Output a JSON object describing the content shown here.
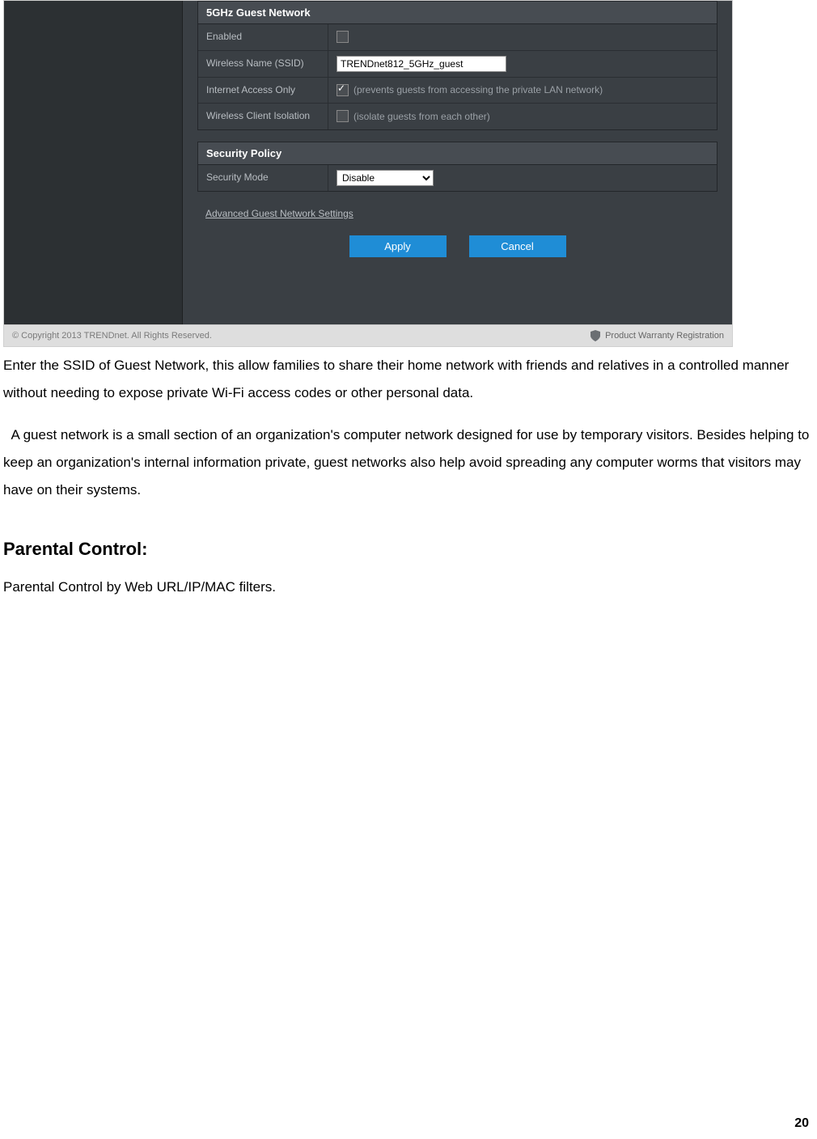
{
  "router": {
    "guest_header": "5GHz Guest Network",
    "rows": {
      "enabled_label": "Enabled",
      "ssid_label": "Wireless Name (SSID)",
      "ssid_value": "TRENDnet812_5GHz_guest",
      "iao_label": "Internet Access Only",
      "iao_note": "(prevents guests from accessing the private LAN network)",
      "wci_label": "Wireless Client Isolation",
      "wci_note": "(isolate guests from each other)"
    },
    "sec_header": "Security Policy",
    "sec_mode_label": "Security Mode",
    "sec_mode_value": "Disable",
    "adv_link": "Advanced Guest Network Settings",
    "apply": "Apply",
    "cancel": "Cancel",
    "footer_left": "© Copyright 2013 TRENDnet. All Rights Reserved.",
    "footer_right": "Product Warranty Registration"
  },
  "doc": {
    "p1": "Enter the SSID of Guest Network, this allow families to share their home network with friends and relatives in a controlled manner without needing to expose private Wi-Fi access codes or other personal data.",
    "p2": "  A guest network is a small section of an organization's computer network designed for use by temporary visitors. Besides helping to keep an organization's internal information private, guest networks also help avoid spreading any computer worms that visitors may have on their systems.",
    "h2": "Parental Control:",
    "p3": "Parental Control by Web URL/IP/MAC filters."
  },
  "page_number": "20"
}
